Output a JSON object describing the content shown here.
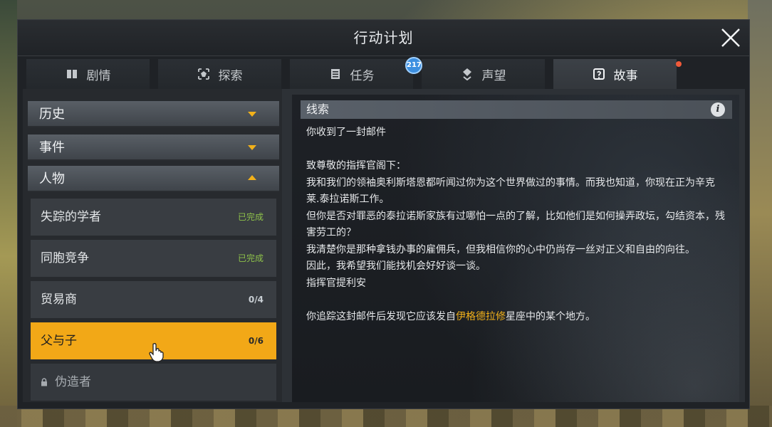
{
  "window": {
    "title": "行动计划"
  },
  "tabs": [
    {
      "label": "剧情",
      "icon": "book-icon"
    },
    {
      "label": "探索",
      "icon": "explore-icon"
    },
    {
      "label": "任务",
      "icon": "clipboard-icon",
      "badge": "217"
    },
    {
      "label": "声望",
      "icon": "reputation-icon"
    },
    {
      "label": "故事",
      "icon": "story-icon",
      "active": true,
      "has_notification": true
    }
  ],
  "sidebar": {
    "categories": [
      {
        "label": "历史",
        "expanded": false
      },
      {
        "label": "事件",
        "expanded": false
      },
      {
        "label": "人物",
        "expanded": true
      }
    ],
    "items": [
      {
        "label": "失踪的学者",
        "status": "已完成"
      },
      {
        "label": "同胞竞争",
        "status": "已完成"
      },
      {
        "label": "贸易商",
        "status": "0/4"
      },
      {
        "label": "父与子",
        "status": "0/6",
        "selected": true
      },
      {
        "label": "伪造者",
        "locked": true
      }
    ]
  },
  "clue": {
    "header": "线索",
    "subject": "你收到了一封邮件",
    "lines": [
      "致尊敬的指挥官阁下：",
      "我和我们的领袖奥利斯塔恩都听闻过你为这个世界做过的事情。而我也知道，你现在正为辛克莱.泰拉诺斯工作。",
      "但你是否对罪恶的泰拉诺斯家族有过哪怕一点的了解，比如他们是如何操弄政坛，勾结资本，残害劳工的？",
      "我清楚你是那种拿钱办事的雇佣兵，但我相信你的心中仍尚存一丝对正义和自由的向往。",
      "因此，我希望我们能找机会好好谈一谈。",
      "指挥官提利安"
    ],
    "footer_before": "你追踪这封邮件后发现它应该发自",
    "footer_highlight": "伊格德拉修",
    "footer_after": "星座中的某个地方。"
  },
  "colors": {
    "accent": "#f2a817",
    "done": "#8ec24a",
    "badge": "#3d8fe0",
    "notification": "#f05a3a"
  }
}
